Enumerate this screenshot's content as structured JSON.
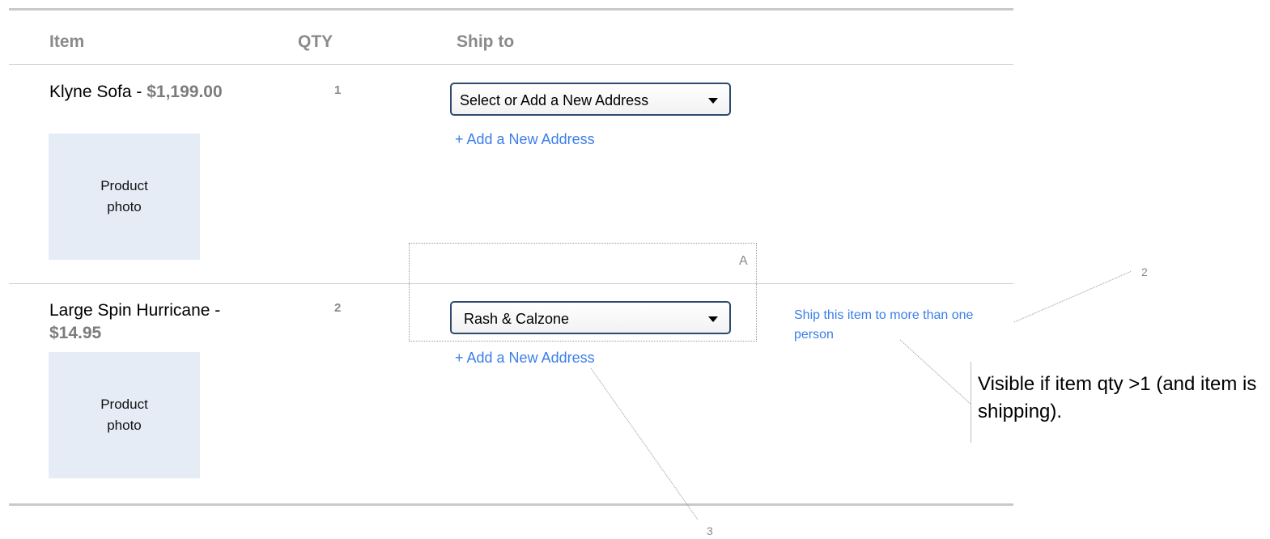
{
  "header": {
    "item_col": "Item",
    "qty_col": "QTY",
    "ship_col": "Ship to"
  },
  "items": [
    {
      "name": "Klyne Sofa - ",
      "price": "$1,199.00",
      "qty": "1",
      "photo_label": "Product photo",
      "ship_select": "Select or Add a New Address",
      "add_address": "+ Add a New Address"
    },
    {
      "name": "Large Spin Hurricane - ",
      "price": "$14.95",
      "qty": "2",
      "photo_label": "Product photo",
      "ship_select": "Rash & Calzone",
      "add_address": "+ Add a New Address",
      "multi_ship_link": "Ship this item to more than one person"
    }
  ],
  "annotations": {
    "box_label": "A",
    "marker_2": "2",
    "marker_3": "3",
    "note": "Visible if item qty >1 (and item is shipping)."
  },
  "colors": {
    "link": "#3b7ee8",
    "photo_bg": "#e5ecf6",
    "select_border": "#2c4a6e"
  }
}
